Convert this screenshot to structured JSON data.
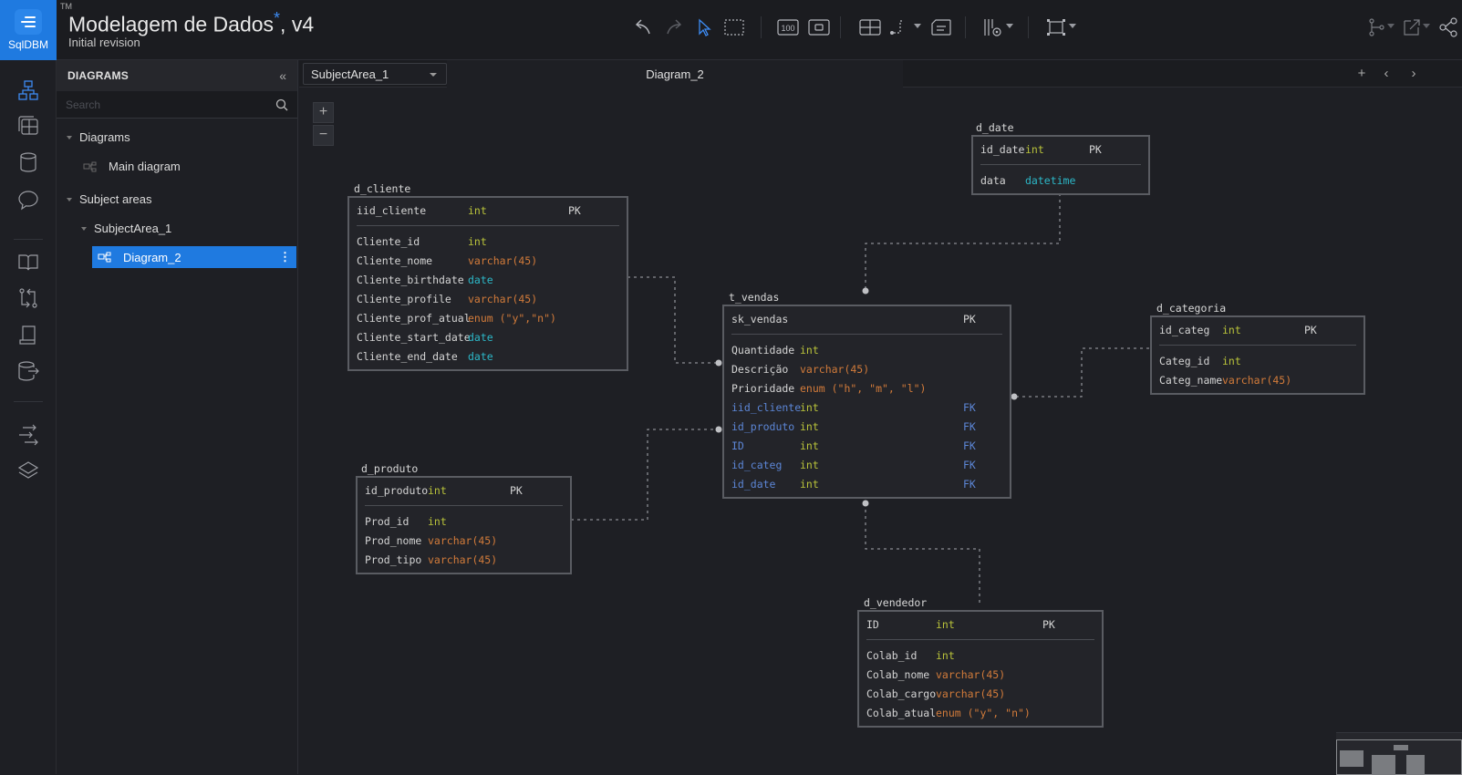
{
  "app": {
    "logo_label": "SqlDBM",
    "tm": "TM",
    "title": "Modelagem de Dados",
    "title_modified_marker": "*",
    "title_version": ", v4",
    "subtitle": "Initial revision"
  },
  "toolbar": {
    "icons": [
      "undo-icon",
      "redo-icon",
      "pointer-icon",
      "marquee-select-icon",
      "zoom-100-icon",
      "fit-icon",
      "grid-icon",
      "relationship-line-icon",
      "note-icon",
      "visibility-icon",
      "fit-screen-icon",
      "branch-icon",
      "export-icon",
      "share-icon"
    ],
    "zoom_100_label": "100"
  },
  "rail": {
    "items": [
      "diagram-icon",
      "table-icon",
      "database-icon",
      "comment-icon",
      "book-icon",
      "compare-icon",
      "document-icon",
      "db-export-icon",
      "forward-engineer-icon",
      "layers-icon"
    ]
  },
  "panel": {
    "header": "DIAGRAMS",
    "search_placeholder": "Search",
    "tree": {
      "diagrams_label": "Diagrams",
      "main_diagram": "Main diagram",
      "subject_areas_label": "Subject areas",
      "subject_area": "SubjectArea_1",
      "selected_diagram": "Diagram_2"
    }
  },
  "tabbar": {
    "subject_area_select": "SubjectArea_1",
    "active_tab": "Diagram_2"
  },
  "colors": {
    "accent": "#1f7ae0",
    "int": "#b8c23a",
    "varchar": "#d27b3a",
    "date": "#2cb8c8",
    "fk": "#5c86d6"
  },
  "tables": {
    "d_cliente": {
      "name": "d_cliente",
      "pk": {
        "name": "iid_cliente",
        "type": "int",
        "key": "PK"
      },
      "columns": [
        {
          "name": "Cliente_id",
          "type": "int"
        },
        {
          "name": "Cliente_nome",
          "type": "varchar(45)"
        },
        {
          "name": "Cliente_birthdate",
          "type": "date"
        },
        {
          "name": "Cliente_profile",
          "type": "varchar(45)"
        },
        {
          "name": "Cliente_prof_atual",
          "type": "enum (\"y\",\"n\")"
        },
        {
          "name": "Cliente_start_date",
          "type": "date"
        },
        {
          "name": "Cliente_end_date",
          "type": "date"
        }
      ]
    },
    "d_date": {
      "name": "d_date",
      "pk": {
        "name": "id_date",
        "type": "int",
        "key": "PK"
      },
      "columns": [
        {
          "name": "data",
          "type": "datetime"
        }
      ]
    },
    "t_vendas": {
      "name": "t_vendas",
      "pk": {
        "name": "sk_vendas",
        "type": "",
        "key": "PK"
      },
      "columns": [
        {
          "name": "Quantidade",
          "type": "int"
        },
        {
          "name": "Descrição",
          "type": "varchar(45)"
        },
        {
          "name": "Prioridade",
          "type": "enum (\"h\", \"m\", \"l\")"
        },
        {
          "name": "iid_cliente",
          "type": "int",
          "key": "FK"
        },
        {
          "name": "id_produto",
          "type": "int",
          "key": "FK"
        },
        {
          "name": "ID",
          "type": "int",
          "key": "FK"
        },
        {
          "name": "id_categ",
          "type": "int",
          "key": "FK"
        },
        {
          "name": "id_date",
          "type": "int",
          "key": "FK"
        }
      ]
    },
    "d_categoria": {
      "name": "d_categoria",
      "pk": {
        "name": "id_categ",
        "type": "int",
        "key": "PK"
      },
      "columns": [
        {
          "name": "Categ_id",
          "type": "int"
        },
        {
          "name": "Categ_name",
          "type": "varchar(45)"
        }
      ]
    },
    "d_produto": {
      "name": "d_produto",
      "pk": {
        "name": "id_produto",
        "type": "int",
        "key": "PK"
      },
      "columns": [
        {
          "name": "Prod_id",
          "type": "int"
        },
        {
          "name": "Prod_nome",
          "type": "varchar(45)"
        },
        {
          "name": "Prod_tipo",
          "type": "varchar(45)"
        }
      ]
    },
    "d_vendedor": {
      "name": "d_vendedor",
      "pk": {
        "name": "ID",
        "type": "int",
        "key": "PK"
      },
      "columns": [
        {
          "name": "Colab_id",
          "type": "int"
        },
        {
          "name": "Colab_nome",
          "type": "varchar(45)"
        },
        {
          "name": "Colab_cargo",
          "type": "varchar(45)"
        },
        {
          "name": "Colab_atual",
          "type": "enum (\"y\", \"n\")"
        }
      ]
    }
  },
  "relationships": [
    {
      "from": "d_cliente",
      "to": "t_vendas"
    },
    {
      "from": "d_date",
      "to": "t_vendas"
    },
    {
      "from": "d_categoria",
      "to": "t_vendas"
    },
    {
      "from": "d_produto",
      "to": "t_vendas"
    },
    {
      "from": "d_vendedor",
      "to": "t_vendas"
    }
  ]
}
